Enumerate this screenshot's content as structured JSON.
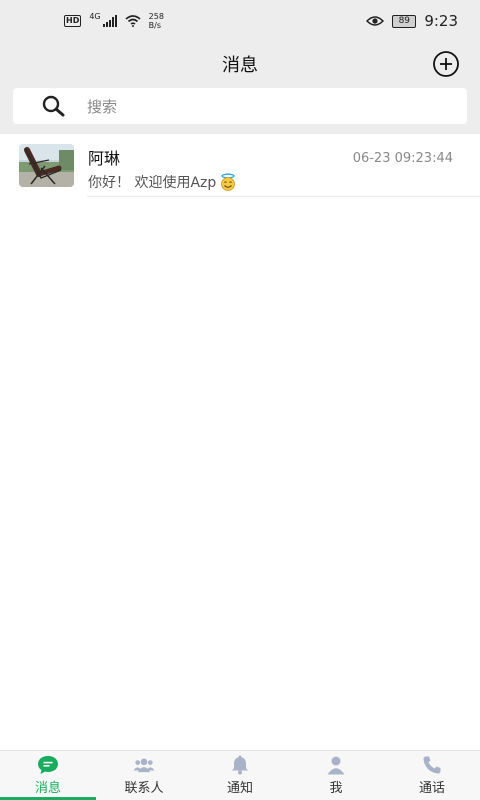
{
  "status_bar": {
    "hd": "HD",
    "network": "4G",
    "speed_value": "258",
    "speed_unit": "B/s",
    "battery": "89",
    "time": "9:23"
  },
  "header": {
    "title": "消息",
    "add_icon": "plus-circle-icon"
  },
  "search": {
    "placeholder": "搜索",
    "icon": "search-icon"
  },
  "conversations": [
    {
      "name": "阿琳",
      "preview": "你好！ 欢迎使用Azp",
      "preview_emoji": "smiling-face-with-halo",
      "time": "06-23 09:23:44",
      "avatar": "reclining-chair-photo"
    }
  ],
  "tabs": [
    {
      "label": "消息",
      "icon": "chat-bubble-icon",
      "active": true
    },
    {
      "label": "联系人",
      "icon": "contacts-icon",
      "active": false
    },
    {
      "label": "通知",
      "icon": "bell-icon",
      "active": false
    },
    {
      "label": "我",
      "icon": "person-icon",
      "active": false
    },
    {
      "label": "通话",
      "icon": "phone-icon",
      "active": false
    }
  ],
  "colors": {
    "accent": "#1aad5f",
    "header_bg": "#ededed",
    "tab_inactive_icon": "#a9b3c7"
  }
}
